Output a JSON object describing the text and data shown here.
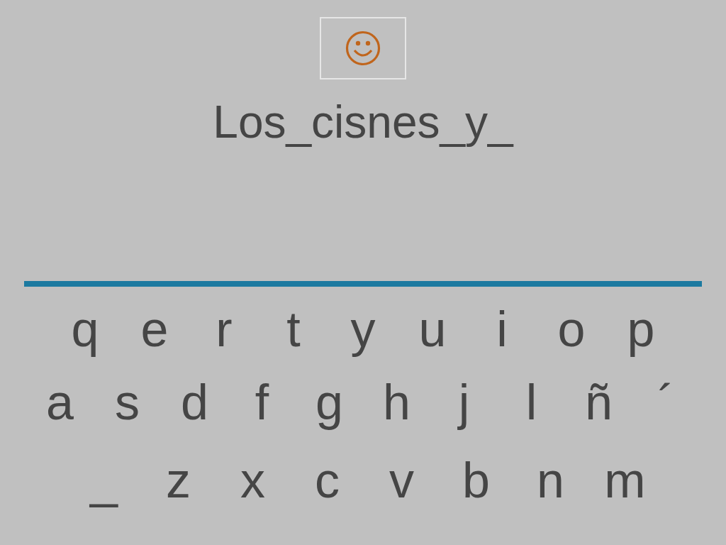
{
  "answer_text": "Los_cisnes_y_",
  "keyboard": {
    "rows": [
      [
        "q",
        "e",
        "r",
        "t",
        "y",
        "u",
        "i",
        "o",
        "p"
      ],
      [
        "a",
        "s",
        "d",
        "f",
        "g",
        "h",
        "j",
        "l",
        "ñ",
        "´"
      ],
      [
        "_",
        "z",
        "x",
        "c",
        "v",
        "b",
        "n",
        "m"
      ]
    ]
  }
}
